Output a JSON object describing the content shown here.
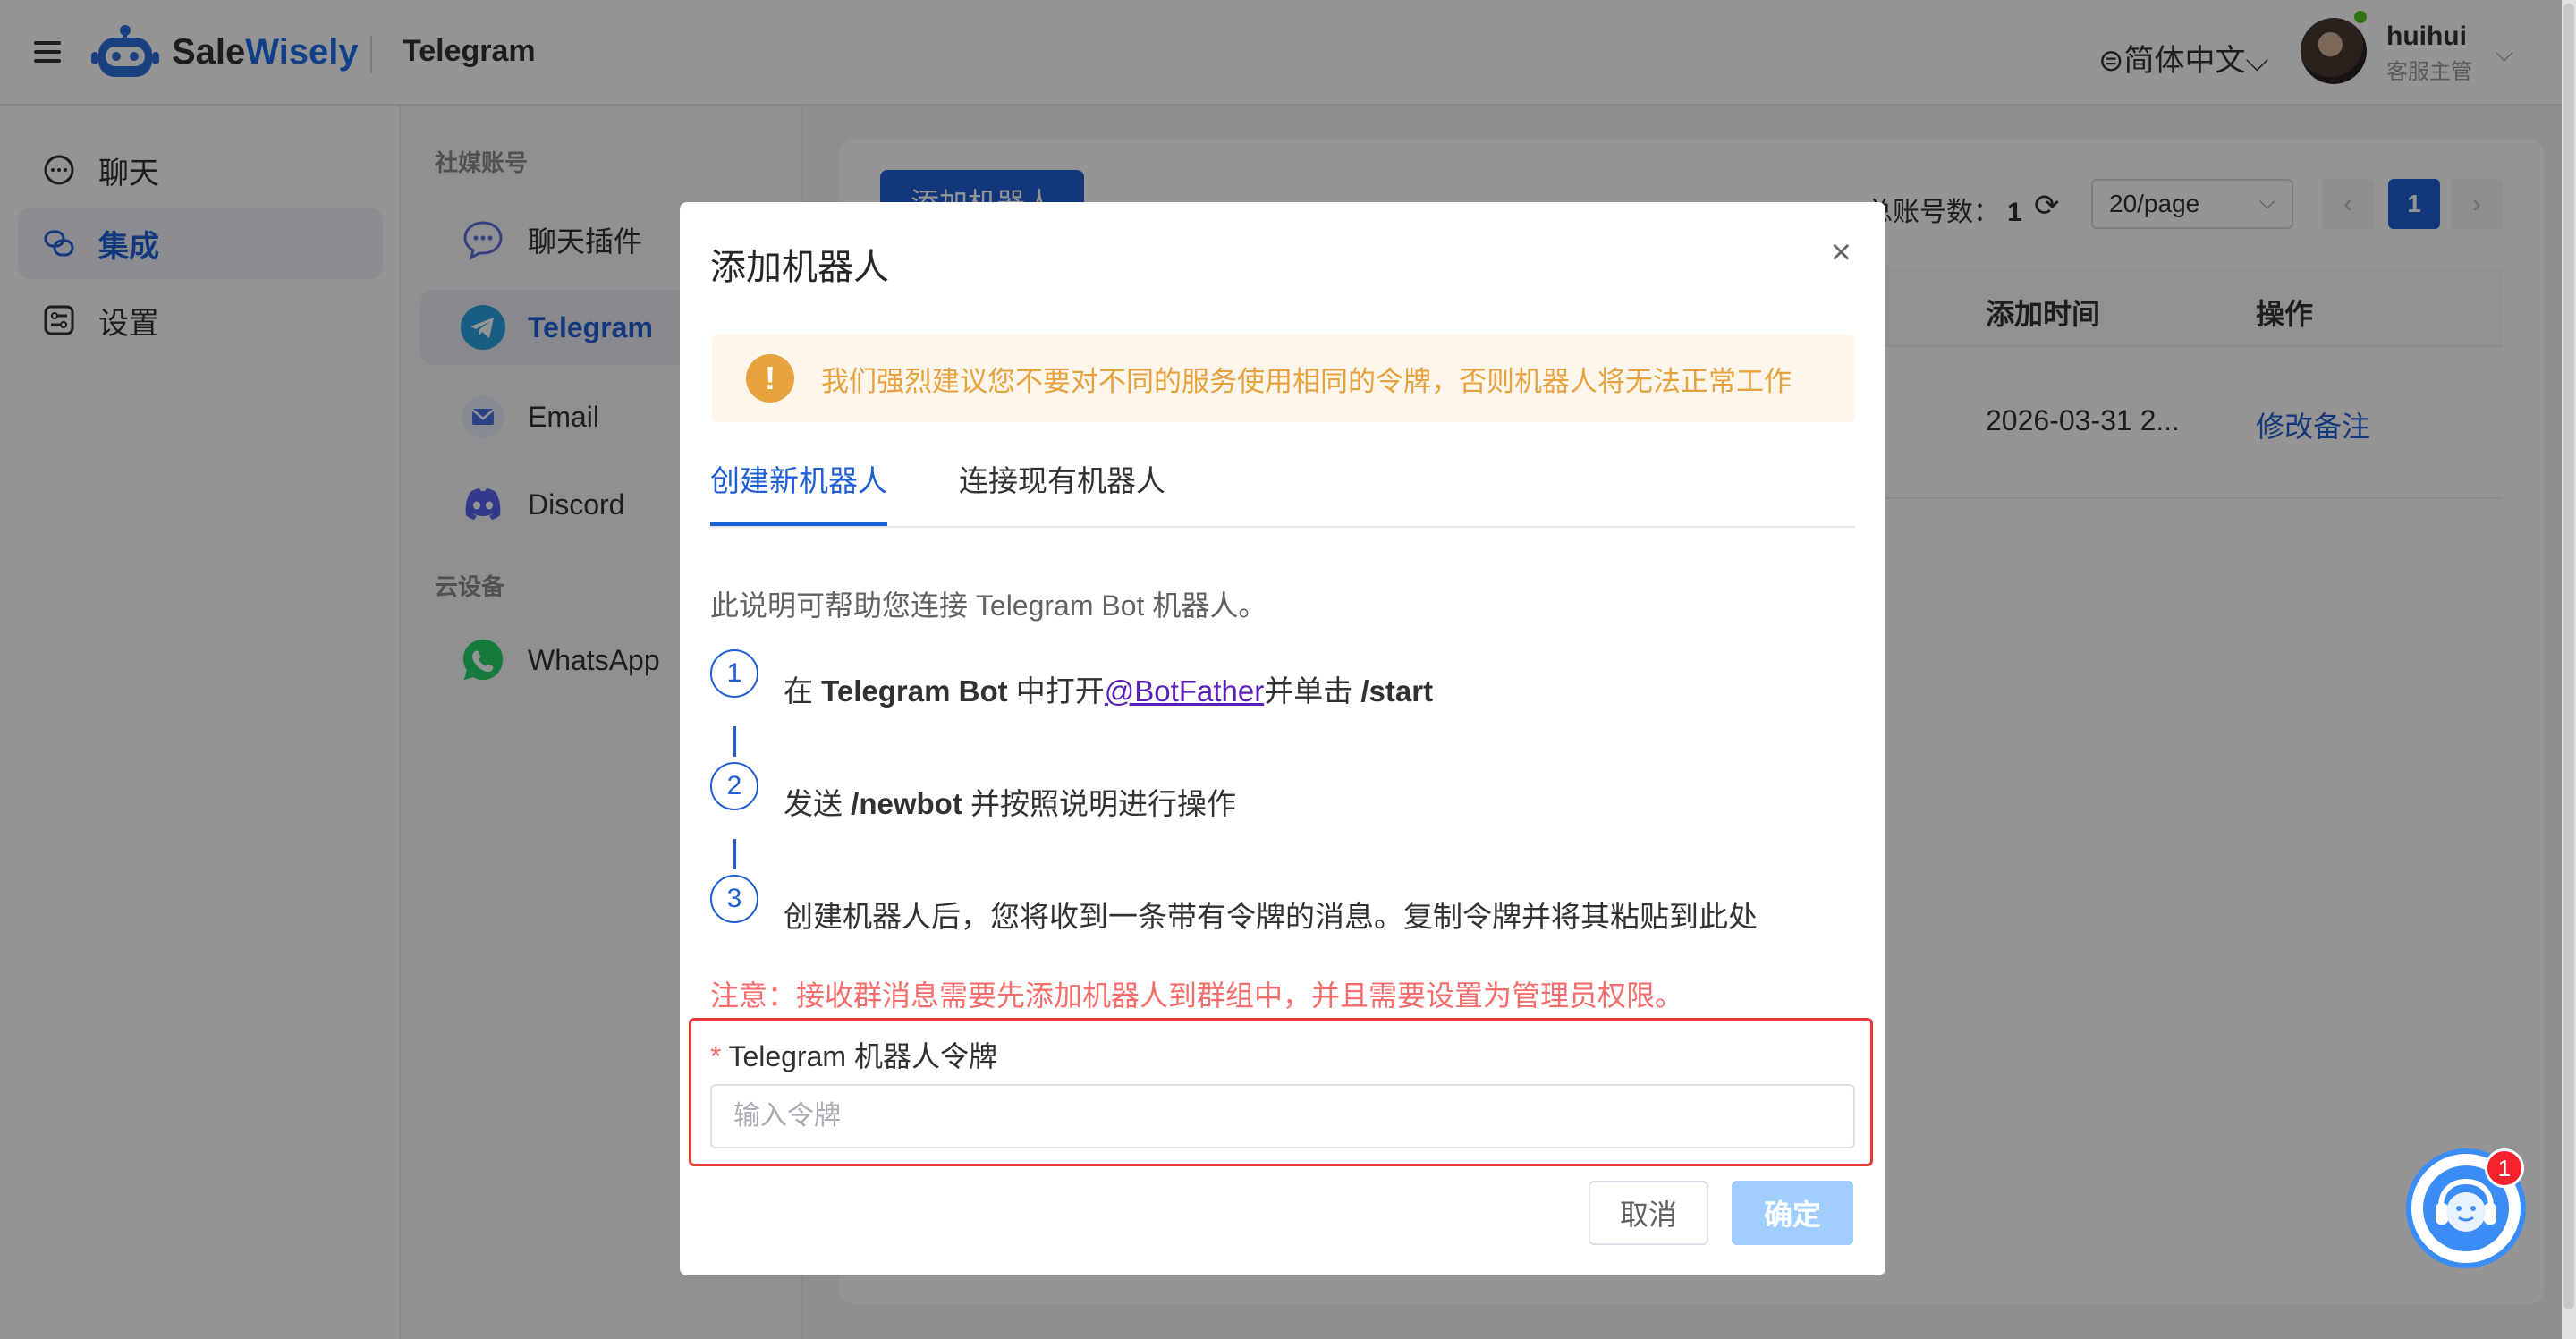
{
  "header": {
    "brand_part1": "Sale",
    "brand_part2": "Wisely",
    "page_title": "Telegram",
    "language": "简体中文",
    "user_name": "huihui",
    "user_role": "客服主管"
  },
  "leftnav": {
    "items": [
      {
        "label": "聊天",
        "icon": "chat-bubble-icon"
      },
      {
        "label": "集成",
        "icon": "link-icon",
        "active": true
      },
      {
        "label": "设置",
        "icon": "settings-panel-icon"
      }
    ]
  },
  "secnav": {
    "section_social": "社媒账号",
    "section_cloud": "云设备",
    "items": [
      {
        "label": "聊天插件",
        "icon": "chat-plugin-icon"
      },
      {
        "label": "Telegram",
        "icon": "telegram-icon",
        "active": true
      },
      {
        "label": "Email",
        "icon": "email-icon"
      },
      {
        "label": "Discord",
        "icon": "discord-icon"
      },
      {
        "label": "WhatsApp",
        "icon": "whatsapp-icon"
      }
    ]
  },
  "main": {
    "add_button": "添加机器人",
    "total_label": "总账号数：",
    "total_value": "1",
    "page_size": "20/page",
    "current_page": "1",
    "columns": {
      "added_time": "添加时间",
      "actions": "操作"
    },
    "rows": [
      {
        "added_time": "2026-03-31 2...",
        "action": "修改备注"
      }
    ]
  },
  "modal": {
    "title": "添加机器人",
    "warning": "我们强烈建议您不要对不同的服务使用相同的令牌，否则机器人将无法正常工作",
    "tabs": [
      "创建新机器人",
      "连接现有机器人"
    ],
    "description": "此说明可帮助您连接 Telegram Bot 机器人。",
    "steps": [
      {
        "num": "1",
        "pre": "在 ",
        "bold1": "Telegram Bot",
        "mid": " 中打开",
        "link": "@BotFather",
        "post": "并单击 ",
        "bold2": "/start"
      },
      {
        "num": "2",
        "pre": "发送 ",
        "bold1": "/newbot",
        "post": " 并按照说明进行操作"
      },
      {
        "num": "3",
        "text": "创建机器人后，您将收到一条带有令牌的消息。复制令牌并将其粘贴到此处"
      }
    ],
    "note": "注意：接收群消息需要先添加机器人到群组中，并且需要设置为管理员权限。",
    "token_label": "Telegram 机器人令牌",
    "token_required": "*",
    "token_placeholder": "输入令牌",
    "token_value": "",
    "cancel": "取消",
    "confirm": "确定"
  },
  "support": {
    "badge": "1"
  },
  "colors": {
    "primary": "#1f5fd6",
    "warning": "#e6a23c",
    "danger": "#f56c6c",
    "highlight_box": "#e53935"
  }
}
